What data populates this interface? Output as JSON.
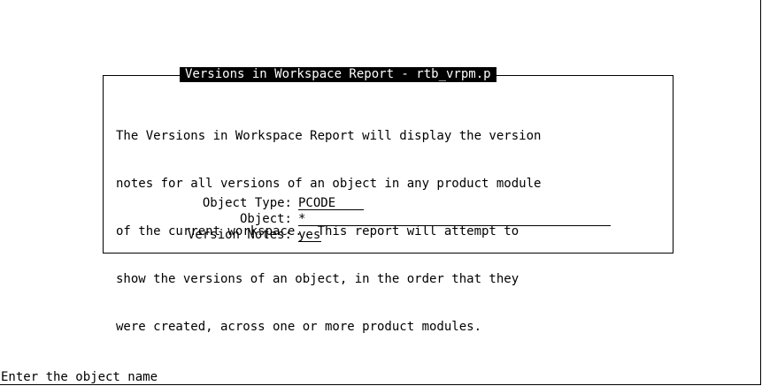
{
  "dialog": {
    "title": "Versions in Workspace Report - rtb_vrpm.p",
    "description_lines": [
      "The Versions in Workspace Report will display the version",
      "notes for all versions of an object in any product module",
      "of the current workspace.  This report will attempt to",
      "show the versions of an object, in the order that they",
      "were created, across one or more product modules."
    ],
    "fields": {
      "object_type": {
        "label": "Object Type:",
        "value": "PCODE"
      },
      "object": {
        "label": "Object:",
        "value": "*"
      },
      "version_notes": {
        "label": "Version Notes:",
        "value": "yes"
      }
    }
  },
  "status_line": "Enter the object name"
}
